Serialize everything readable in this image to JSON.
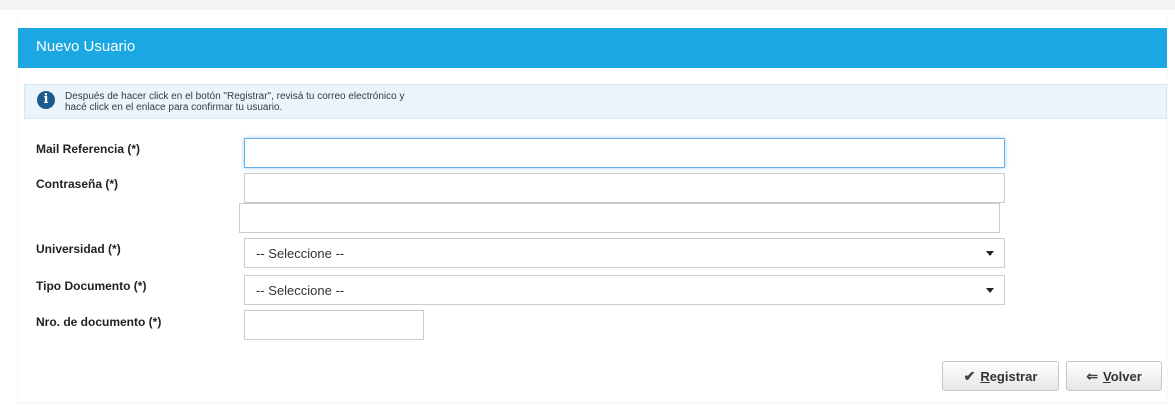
{
  "panel": {
    "title": "Nuevo Usuario"
  },
  "info": {
    "line1": "Después de hacer click en el botón \"Registrar\", revisá tu correo electrónico y",
    "line2": "hacé click en el enlace para confirmar tu usuario.",
    "icon": "info-icon"
  },
  "form": {
    "mail_label": "Mail Referencia (*)",
    "mail_value": "",
    "password_label": "Contraseña (*)",
    "password_value": "",
    "password_confirm_value": "",
    "university_label": "Universidad (*)",
    "university_value": "-- Seleccione --",
    "doc_type_label": "Tipo Documento (*)",
    "doc_type_value": "-- Seleccione --",
    "doc_number_label": "Nro. de documento (*)",
    "doc_number_value": ""
  },
  "buttons": {
    "register_first": "R",
    "register_rest": "egistrar",
    "register_icon": "check-icon",
    "back_first": "V",
    "back_rest": "olver",
    "back_icon": "arrow-left-icon"
  },
  "colors": {
    "header": "#1aa7e2",
    "info_bg": "#eaf4fb",
    "info_icon": "#1d5a8d"
  }
}
